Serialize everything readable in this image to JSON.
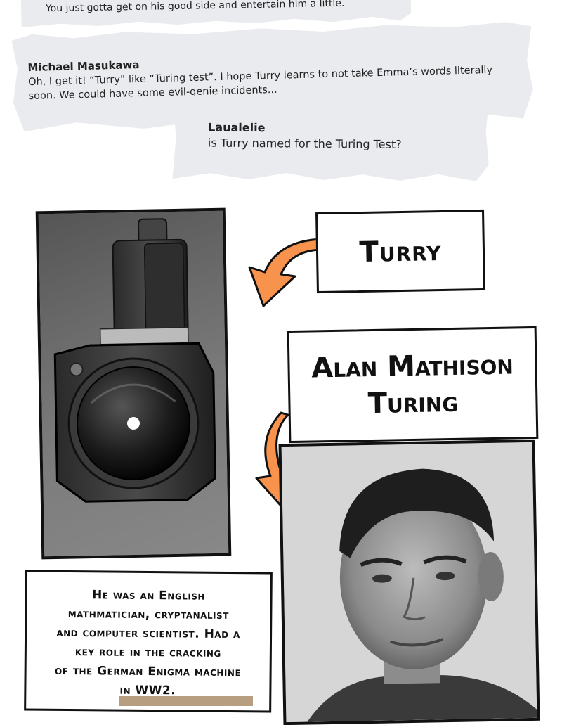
{
  "comments": [
    {
      "name": "",
      "text": "You just gotta get on his good side and entertain him a little."
    },
    {
      "name": "Michael Masukawa",
      "text": "Oh, I get it! “Turry” like “Turing test”. I hope Turry learns to not take Emma’s words literally soon. We could have some evil-genie incidents..."
    },
    {
      "name": "Laualelie",
      "text": "is Turry named for the Turing Test?"
    }
  ],
  "labels": {
    "turry": "Turry",
    "alan_line1": "Alan Mathison",
    "alan_line2": "Turing"
  },
  "bio": {
    "line1": "He was an English",
    "line2": "mathmatician, cryptanalist",
    "line3": "and computer scientist. Had a",
    "line4": "key role in the cracking",
    "line5": "of the German Enigma machine",
    "line6": "in WW2."
  },
  "colors": {
    "arrow": "#f7934c",
    "paper": "#e9ebee",
    "ink": "#111111"
  },
  "icons": {
    "camera": "security-camera",
    "portrait": "portrait-photo"
  }
}
